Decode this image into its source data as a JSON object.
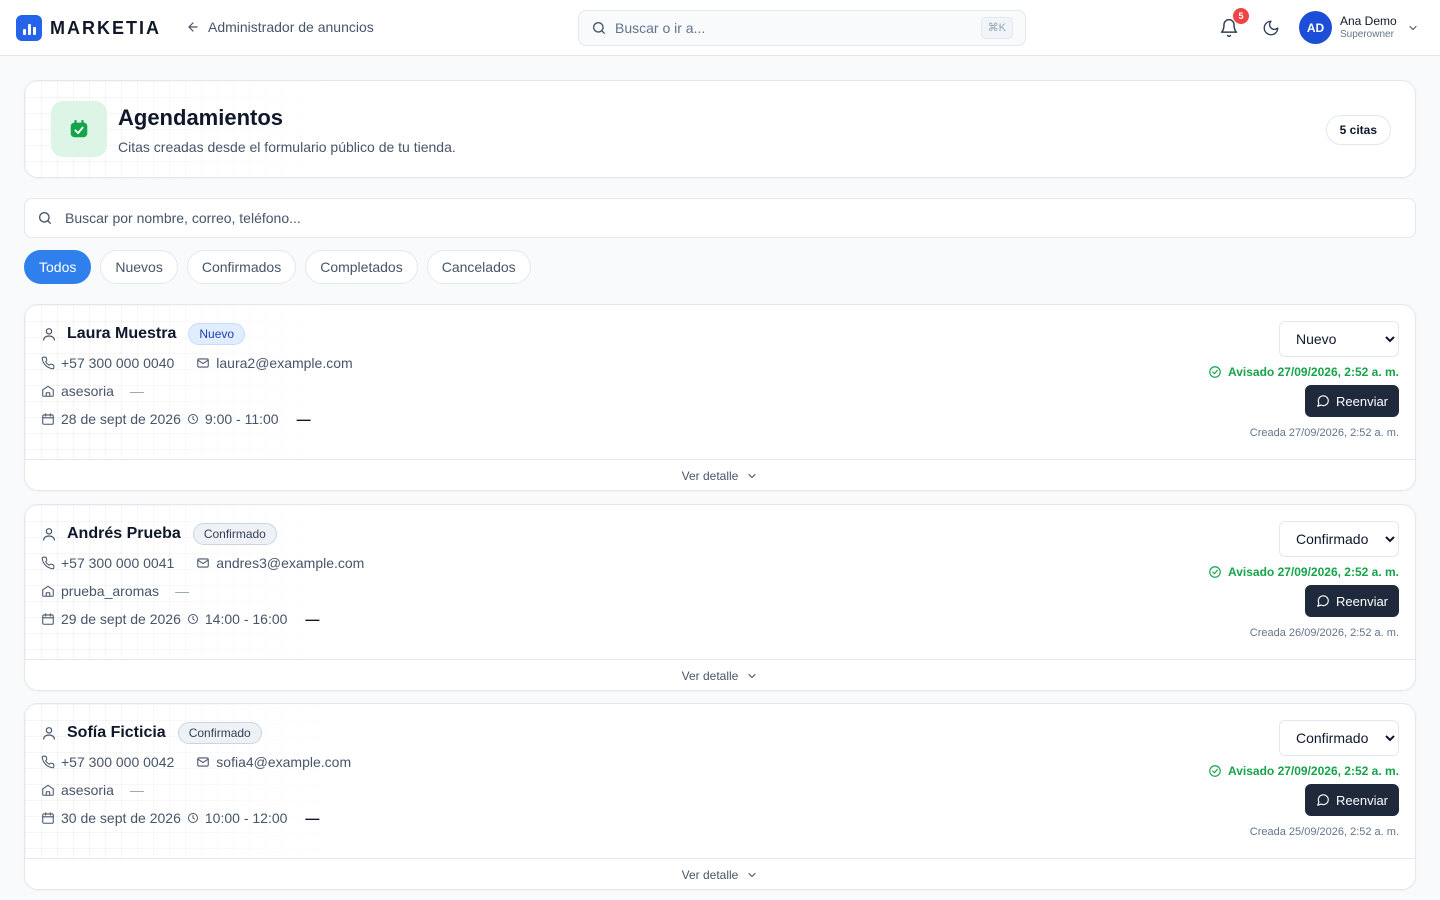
{
  "brand": {
    "name": "MARKETIA",
    "color": "#2563eb"
  },
  "nav": {
    "back_label": "Administrador de anuncios"
  },
  "search": {
    "placeholder": "Buscar o ir a...",
    "shortcut": "⌘K"
  },
  "notifications": {
    "count": "5"
  },
  "user": {
    "initials": "AD",
    "name": "Ana Demo",
    "role": "Superowner"
  },
  "page": {
    "title": "Agendamientos",
    "subtitle": "Citas creadas desde el formulario público de tu tienda.",
    "count_label": "5 citas",
    "accent": "#16a34a"
  },
  "filter": {
    "placeholder": "Buscar por nombre, correo, teléfono..."
  },
  "tabs": [
    "Todos",
    "Nuevos",
    "Confirmados",
    "Completados",
    "Cancelados"
  ],
  "status_options": [
    "Nuevo",
    "Confirmado",
    "Completado",
    "Cancelado"
  ],
  "resend_label": "Reenviar",
  "detail_label": "Ver detalle",
  "appointments": [
    {
      "name": "Laura Muestra",
      "badge": "Nuevo",
      "phone": "+57 300 000 0040",
      "email": "laura2@example.com",
      "service": "asesoria",
      "service_extra": "—",
      "date": "28 de sept de 2026",
      "time": "9:00 - 11:00",
      "time_extra": "—",
      "status": "Nuevo",
      "notified": "Avisado 27/09/2026, 2:52 a. m.",
      "created": "Creada 27/09/2026, 2:52 a. m."
    },
    {
      "name": "Andrés Prueba",
      "badge": "Confirmado",
      "phone": "+57 300 000 0041",
      "email": "andres3@example.com",
      "service": "prueba_aromas",
      "service_extra": "—",
      "date": "29 de sept de 2026",
      "time": "14:00 - 16:00",
      "time_extra": "—",
      "status": "Confirmado",
      "notified": "Avisado 27/09/2026, 2:52 a. m.",
      "created": "Creada 26/09/2026, 2:52 a. m."
    },
    {
      "name": "Sofía Ficticia",
      "badge": "Confirmado",
      "phone": "+57 300 000 0042",
      "email": "sofia4@example.com",
      "service": "asesoria",
      "service_extra": "—",
      "date": "30 de sept de 2026",
      "time": "10:00 - 12:00",
      "time_extra": "—",
      "status": "Confirmado",
      "notified": "Avisado 27/09/2026, 2:52 a. m.",
      "created": "Creada 25/09/2026, 2:52 a. m."
    }
  ]
}
